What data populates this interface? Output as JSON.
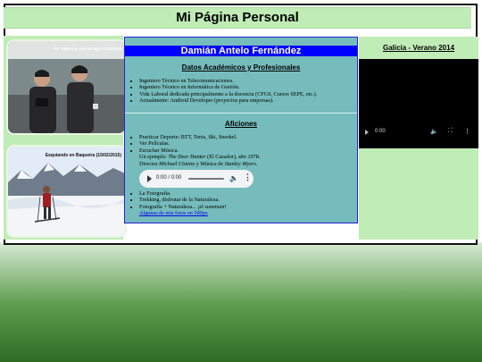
{
  "header": {
    "title": "Mi Página Personal"
  },
  "photos": [
    {
      "caption": "En Valencia, con mi hijo 07/12/2014"
    },
    {
      "caption": "Esquiando en Baqueira (15/02/2015)"
    }
  ],
  "profile": {
    "name": "Damián Antelo Fernández",
    "academic_title": "Datos Académicos y Profesionales",
    "academic_items": [
      "Ingeniero Técnico en Telecomunicaciones.",
      "Ingeniero Técnico en Informática de Gestión.",
      "Vida Laboral dedicada principalmente a la docencia (CFGS, Cursos SEPE, etc.).",
      "Actualmente: Android Developer (proyectos para empresas)."
    ],
    "hobbies_title": "Aficiones",
    "hobbies": {
      "sport": "Practicar Deporte: BTT, Tenis, Ski, Snorkel.",
      "films": "Ver Películas.",
      "music": "Escuchar Música.",
      "example_prefix": "Un ejemplo: ",
      "example_film": "The Deer Hunter",
      "example_suffix": " (El Cazador), año 1978.",
      "director_prefix": "Director ",
      "director": "Michael Cimino",
      "director_mid": " y Música de ",
      "composer": "Stanley Myers",
      "composer_suffix": ".",
      "photo": "La Fotografía.",
      "trekking": "Trekking, disfrutar de la Naturaleza.",
      "photo_nature_prefix": "Fotografía + Naturaleza... ¡el ",
      "photo_nature_em": "summum",
      "photo_nature_suffix": "!",
      "link": "Algunas de mis fotos en 500px"
    },
    "audio": {
      "time": "0:00 / 0:00"
    }
  },
  "right": {
    "title": "Galicia - Verano 2014",
    "video_time": "0:00"
  },
  "colors": {
    "panel_green": "#c0ecb6",
    "center_teal": "#76bcbc",
    "name_blue": "#0000ff"
  }
}
